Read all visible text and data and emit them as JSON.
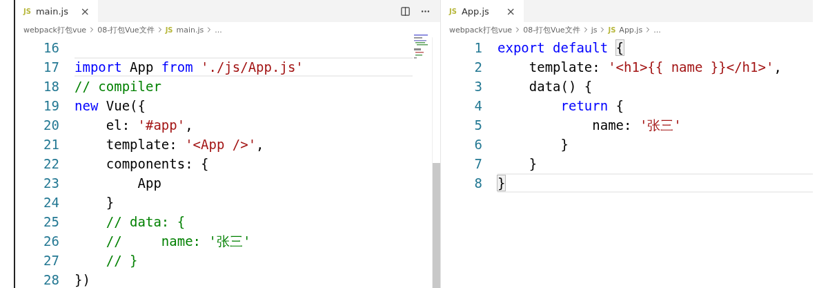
{
  "editors": [
    {
      "tab": {
        "icon_text": "JS",
        "label": "main.js",
        "close": "×",
        "selected": true
      },
      "actions": true,
      "breadcrumbs": [
        {
          "label": "webpack打包vue"
        },
        {
          "label": "08-打包Vue文件"
        },
        {
          "icon_text": "JS",
          "label": "main.js"
        },
        {
          "label": "..."
        }
      ],
      "minimap": true,
      "scrollbar": {
        "level": 0.5
      },
      "lines": [
        {
          "number": "16",
          "current": false
        },
        {
          "number": "17",
          "current": true,
          "tokens": [
            {
              "kind": "keyword",
              "text": "import"
            },
            {
              "kind": "plain",
              "text": " App "
            },
            {
              "kind": "keyword",
              "text": "from "
            },
            {
              "kind": "string",
              "text": "'./js/App.js'"
            }
          ]
        },
        {
          "number": "18",
          "current": false,
          "tokens": [
            {
              "kind": "comment",
              "text": "// compiler"
            }
          ]
        },
        {
          "number": "19",
          "current": false,
          "tokens": [
            {
              "kind": "keyword",
              "text": "new"
            },
            {
              "kind": "plain",
              "text": " Vue({"
            }
          ]
        },
        {
          "number": "20",
          "current": false,
          "tokens": [
            {
              "kind": "plain",
              "text": "    el: "
            },
            {
              "kind": "string",
              "text": "'#app'"
            },
            {
              "kind": "plain",
              "text": ","
            }
          ]
        },
        {
          "number": "21",
          "current": false,
          "tokens": [
            {
              "kind": "plain",
              "text": "    template: "
            },
            {
              "kind": "string",
              "text": "'<App />'"
            },
            {
              "kind": "plain",
              "text": ","
            }
          ]
        },
        {
          "number": "22",
          "current": false,
          "tokens": [
            {
              "kind": "plain",
              "text": "    components: {"
            }
          ]
        },
        {
          "number": "23",
          "current": false,
          "tokens": [
            {
              "kind": "plain",
              "text": "        App"
            }
          ]
        },
        {
          "number": "24",
          "current": false,
          "tokens": [
            {
              "kind": "plain",
              "text": "    }"
            }
          ]
        },
        {
          "number": "25",
          "current": false,
          "tokens": [
            {
              "kind": "comment",
              "text": "    // data: {"
            }
          ]
        },
        {
          "number": "26",
          "current": false,
          "tokens": [
            {
              "kind": "comment",
              "text": "    //     name: '张三'"
            }
          ]
        },
        {
          "number": "27",
          "current": false,
          "tokens": [
            {
              "kind": "comment",
              "text": "    // }"
            }
          ]
        },
        {
          "number": "28",
          "current": false,
          "tokens": [
            {
              "kind": "plain",
              "text": "})"
            }
          ]
        }
      ]
    },
    {
      "tab": {
        "icon_text": "JS",
        "label": "App.js",
        "close": "×",
        "selected": true
      },
      "actions": false,
      "breadcrumbs": [
        {
          "label": "webpack打包vue"
        },
        {
          "label": "08-打包Vue文件"
        },
        {
          "label": "js"
        },
        {
          "icon_text": "JS",
          "label": "App.js"
        },
        {
          "label": "..."
        }
      ],
      "minimap": false,
      "lines": [
        {
          "number": "1",
          "current": false,
          "tokens": [
            {
              "kind": "keyword",
              "text": "export "
            },
            {
              "kind": "keyword",
              "text": "default "
            },
            {
              "kind": "bracket-match",
              "text": "{"
            }
          ]
        },
        {
          "number": "2",
          "current": false,
          "tokens": [
            {
              "kind": "plain",
              "text": "    template: "
            },
            {
              "kind": "string",
              "text": "'<h1>{{ name }}</h1>'"
            },
            {
              "kind": "plain",
              "text": ","
            }
          ]
        },
        {
          "number": "3",
          "current": false,
          "tokens": [
            {
              "kind": "plain",
              "text": "    data() {"
            }
          ]
        },
        {
          "number": "4",
          "current": false,
          "tokens": [
            {
              "kind": "keyword",
              "text": "        return"
            },
            {
              "kind": "plain",
              "text": " {"
            }
          ]
        },
        {
          "number": "5",
          "current": false,
          "tokens": [
            {
              "kind": "plain",
              "text": "            name: "
            },
            {
              "kind": "string",
              "text": "'张三'"
            }
          ]
        },
        {
          "number": "6",
          "current": false,
          "tokens": [
            {
              "kind": "plain",
              "text": "        }"
            }
          ]
        },
        {
          "number": "7",
          "current": false,
          "tokens": [
            {
              "kind": "plain",
              "text": "    }"
            }
          ]
        },
        {
          "number": "8",
          "current": true,
          "tokens": [
            {
              "kind": "bracket-match",
              "text": "}"
            }
          ]
        }
      ]
    }
  ]
}
